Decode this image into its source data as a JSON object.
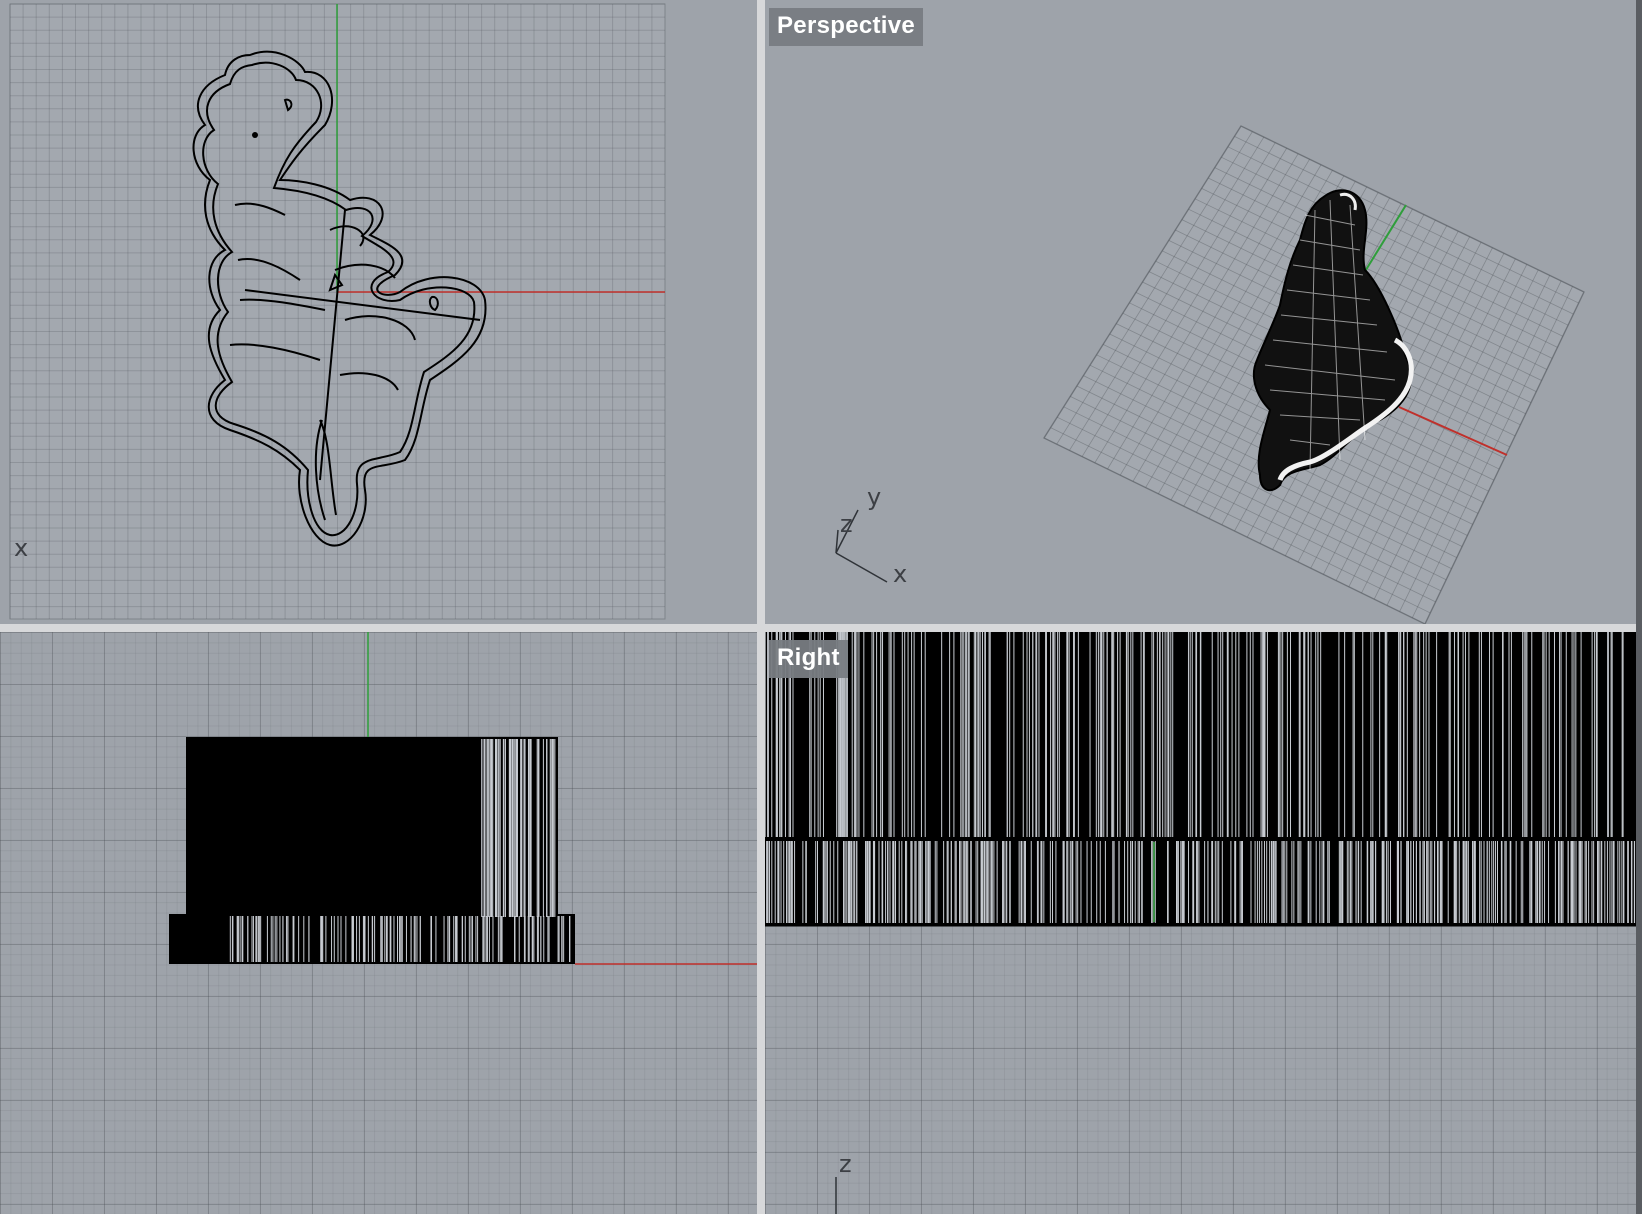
{
  "viewports": {
    "top": {
      "label": "",
      "axis_x": "x"
    },
    "perspective": {
      "label": "Perspective",
      "axis_x": "x",
      "axis_y": "y",
      "axis_z": "z"
    },
    "front": {
      "label": ""
    },
    "right": {
      "label": "Right",
      "axis_z": "z"
    }
  },
  "colors": {
    "viewport_background": "#9ea3aa",
    "x_axis": "#c0302b",
    "y_axis": "#2f9e3b",
    "geometry": "#000000",
    "label_background": "#787c82"
  }
}
